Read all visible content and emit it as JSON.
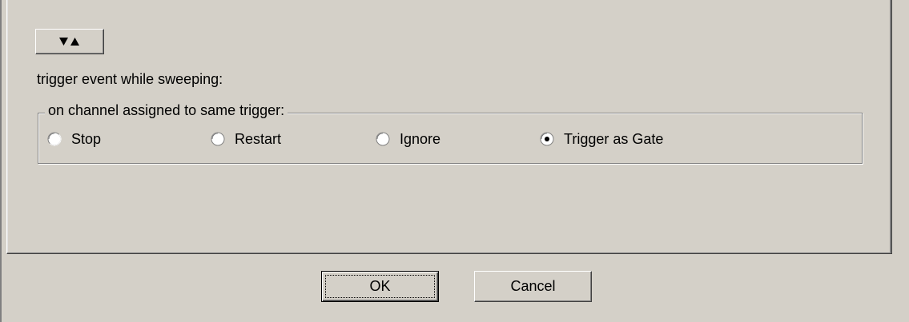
{
  "toggle_button": {
    "icon": "down-up-triangles-icon"
  },
  "trigger_label": "trigger event while sweeping:",
  "group": {
    "legend": "on channel assigned to same trigger:",
    "options": [
      {
        "label": "Stop",
        "checked": false
      },
      {
        "label": "Restart",
        "checked": false
      },
      {
        "label": "Ignore",
        "checked": false
      },
      {
        "label": "Trigger as Gate",
        "checked": true
      }
    ]
  },
  "buttons": {
    "ok_label": "OK",
    "cancel_label": "Cancel"
  },
  "colors": {
    "face": "#d4d0c8",
    "highlight": "#ffffff",
    "shadow": "#808080",
    "dark_shadow": "#404040"
  }
}
